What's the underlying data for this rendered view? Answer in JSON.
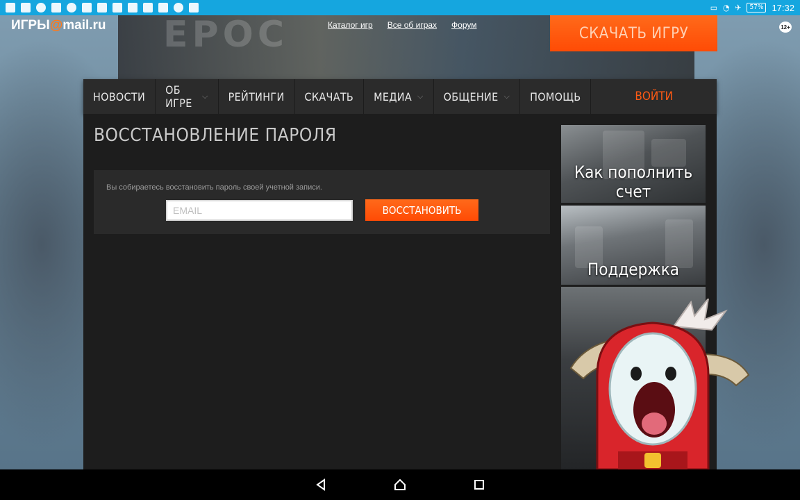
{
  "status_bar": {
    "battery": "57%",
    "time": "17:32"
  },
  "header": {
    "logo_prefix": "ИГРЫ",
    "logo_at": "@",
    "logo_suffix": "mail.ru",
    "hero_text": "EPOC",
    "links": [
      "Каталог игр",
      "Все об играх",
      "Форум"
    ],
    "download_label": "СКАЧАТЬ ИГРУ",
    "age_rating": "12+"
  },
  "nav": {
    "items": [
      {
        "label": "НОВОСТИ",
        "has_dropdown": false
      },
      {
        "label": "ОБ ИГРЕ",
        "has_dropdown": true
      },
      {
        "label": "РЕЙТИНГИ",
        "has_dropdown": false
      },
      {
        "label": "СКАЧАТЬ",
        "has_dropdown": false
      },
      {
        "label": "МЕДИА",
        "has_dropdown": true
      },
      {
        "label": "ОБЩЕНИЕ",
        "has_dropdown": true
      },
      {
        "label": "ПОМОЩЬ",
        "has_dropdown": false
      }
    ],
    "login_label": "ВОЙТИ"
  },
  "main": {
    "title": "ВОССТАНОВЛЕНИЕ ПАРОЛЯ",
    "description": "Вы собираетесь восстановить пароль своей учетной записи.",
    "email_placeholder": "EMAIL",
    "email_value": "",
    "submit_label": "ВОССТАНОВИТЬ"
  },
  "sidebar": {
    "banners": [
      "Как пополнить счет",
      "Поддержка"
    ]
  },
  "colors": {
    "accent": "#ff5a14",
    "statusbar": "#15a6df",
    "nav_bg": "#2b2b2b",
    "panel_bg": "#1d1d1d"
  }
}
